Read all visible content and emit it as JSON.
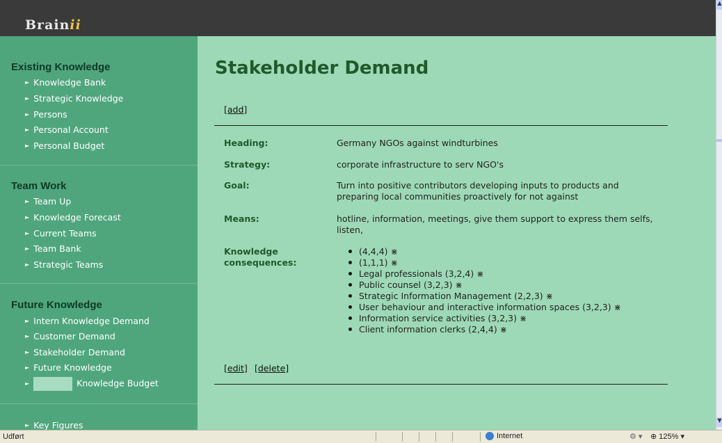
{
  "app": {
    "logo_main": "Brain",
    "logo_accent": "ii"
  },
  "sidebar": {
    "sections": [
      {
        "heading": "Existing Knowledge",
        "items": [
          "Knowledge Bank",
          "Strategic Knowledge",
          "Persons",
          "Personal Account",
          "Personal Budget"
        ]
      },
      {
        "heading": "Team Work",
        "items": [
          "Team Up",
          "Knowledge Forecast",
          "Current Teams",
          "Team Bank",
          "Strategic Teams"
        ]
      },
      {
        "heading": "Future Knowledge",
        "items": [
          "Intern Knowledge Demand",
          "Customer Demand",
          "Stakeholder Demand",
          "Future Knowledge",
          "Knowledge Budget"
        ]
      }
    ],
    "bottom_item": "Key Figures"
  },
  "main": {
    "title": "Stakeholder Demand",
    "add_link": "[add]",
    "fields": {
      "heading_label": "Heading:",
      "heading_value": "Germany NGOs against windturbines",
      "strategy_label": "Strategy:",
      "strategy_value": "corporate infrastructure to serv NGO's",
      "goal_label": "Goal:",
      "goal_value": "Turn into positive contributors developing inputs to products and preparing local communities proactively for not against",
      "means_label": "Means:",
      "means_value": "hotline, information, meetings, give them support to express them selfs, listen,",
      "kc_label_line1": "Knowledge",
      "kc_label_line2": "consequences:"
    },
    "knowledge_consequences": [
      "(4,4,4)",
      "(1,1,1)",
      "Legal professionals (3,2,4)",
      "Public counsel (3,2,3)",
      "Strategic Information Management (2,2,3)",
      "User behaviour and interactive information spaces (3,2,3)",
      "Information service activities (3,2,3)",
      "Client information clerks (2,4,4)"
    ],
    "edit_link": "[edit]",
    "delete_link": "[delete]"
  },
  "statusbar": {
    "status": "Udført",
    "zone": "Internet",
    "zoom": "125%"
  },
  "colors": {
    "sidebar_bg": "#4fa67d",
    "main_bg": "#9dd9b6",
    "header_bg": "#3a3a3a",
    "title_color": "#1f5a2c"
  }
}
